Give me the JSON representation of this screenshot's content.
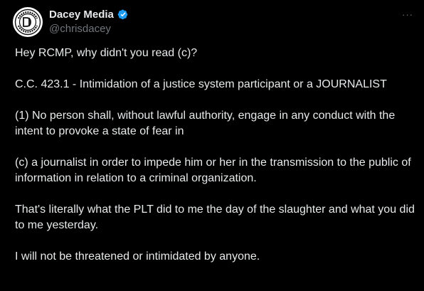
{
  "author": {
    "display_name": "Dacey Media",
    "handle": "@chrisdacey",
    "avatar_logo_text": "DACEY MEDIA",
    "verified": true,
    "verified_color": "#1d9bf0"
  },
  "actions": {
    "more_label": "···"
  },
  "tweet": {
    "paragraphs": [
      "Hey RCMP, why didn't you read (c)?",
      "C.C. 423.1 - Intimidation of a justice system participant or a JOURNALIST",
      "(1) No person shall, without lawful authority, engage in any conduct with the intent to provoke a state of fear in",
      "(c) a journalist in order to impede him or her in the transmission to the public of information in relation to a criminal organization.",
      "That's literally what the PLT did to me the day of the slaughter and what you did to me yesterday.",
      "I will not be threatened or intimidated by anyone."
    ]
  },
  "colors": {
    "background": "#000000",
    "text_primary": "#e7e9ea",
    "text_secondary": "#71767b"
  }
}
